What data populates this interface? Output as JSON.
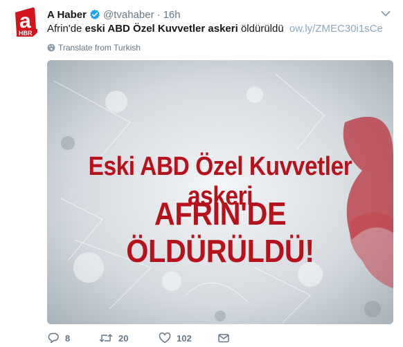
{
  "tweet": {
    "author_name": "A Haber",
    "handle": "@tvahaber",
    "separator": "·",
    "time": "16h",
    "text_part1": "Afrin'de ",
    "text_bold": "eski ABD Özel Kuvvetler askeri",
    "text_part2": " öldürüldü",
    "link": "ow.ly/ZMEC30i1sCe",
    "translate_label": "Translate from Turkish",
    "media": {
      "headline_line1": "Eski ABD Özel Kuvvetler askeri",
      "headline_line2": "AFRİN'DE ÖLDÜRÜLDÜ!"
    },
    "avatar": {
      "logo_letter": "a",
      "logo_sub": "HBR"
    }
  },
  "actions": {
    "reply_count": "8",
    "retweet_count": "20",
    "like_count": "102"
  },
  "icons": {
    "verified": "verified-badge-icon",
    "globe": "globe-icon",
    "reply": "reply-icon",
    "retweet": "retweet-icon",
    "like": "heart-icon",
    "dm": "envelope-icon",
    "caret": "chevron-down-icon"
  },
  "colors": {
    "verified": "#1da1f2",
    "brand_red": "#d3141c",
    "headline_red": "#b5121b",
    "link": "#8fa8bd",
    "muted": "#657786"
  }
}
